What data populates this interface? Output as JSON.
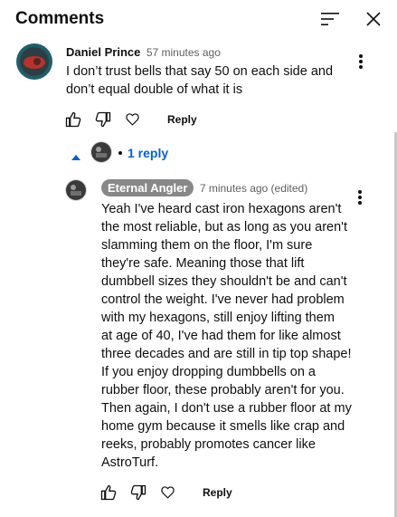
{
  "panel": {
    "title": "Comments",
    "sort_icon": "sort-icon",
    "close_icon": "close-icon"
  },
  "comment": {
    "author": "Daniel Prince",
    "time": "57 minutes ago",
    "text_lines": [
      "I don’t trust bells that say 50 on each side and",
      "don’t equal double of what it is"
    ],
    "reply_label": "Reply",
    "replies_label": "1 reply"
  },
  "reply": {
    "author": "Eternal Angler",
    "time": "7 minutes ago (edited)",
    "text_lines": [
      "Yeah I've heard cast iron hexagons aren't",
      "the most reliable, but as long as you aren't",
      "slamming them on the floor, I'm sure",
      "they're safe.  Meaning those that lift",
      "dumbbell sizes they shouldn't be and can't",
      "control the weight.  I've never had problem",
      "with my hexagons, still enjoy lifting them",
      "at age of 40, I've had them for like almost",
      "three decades and are still in tip top shape!",
      "If you enjoy dropping dumbbells on a",
      "rubber floor, these probably aren't for you.",
      "Then again, I don't use a rubber floor at my",
      "home gym because it smells like crap and",
      "reeks, probably promotes cancer like",
      "AstroTurf."
    ],
    "reply_label": "Reply"
  },
  "colors": {
    "link_blue": "#065fd4",
    "badge_gray": "#888888",
    "text": "#0f0f0f",
    "muted": "#606060"
  }
}
